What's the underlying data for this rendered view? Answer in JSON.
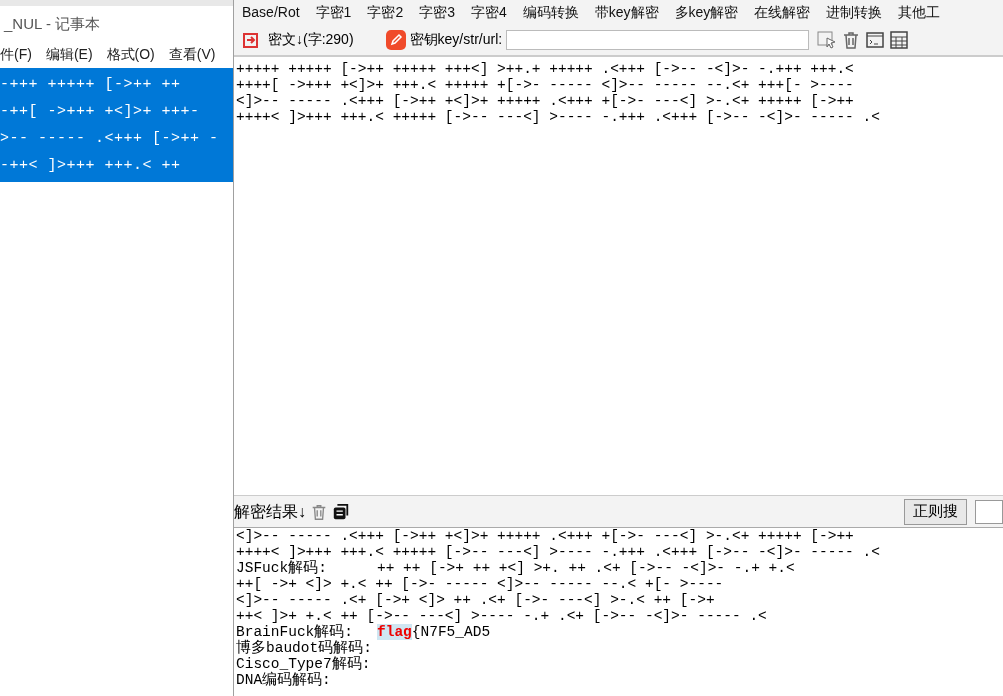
{
  "notepad": {
    "title": "_NUL - 记事本",
    "menu": [
      "件(F)",
      "编辑(E)",
      "格式(O)",
      "查看(V)"
    ],
    "lines": [
      "-+++ +++++ [->++ ++",
      "-++[ ->+++ +<]>+ +++-",
      ">-- ----- .<+++ [->++ -",
      "-++< ]>+++ +++.< ++"
    ]
  },
  "tool": {
    "menu": [
      "Base/Rot",
      "字密1",
      "字密2",
      "字密3",
      "字密4",
      "编码转换",
      "带key解密",
      "多key解密",
      "在线解密",
      "进制转换",
      "其他工"
    ],
    "cipher_label": "密文↓(字:290)",
    "key_label": "密钥key/str/url:",
    "cipher_lines": [
      "+++++ +++++ [->++ +++++ +++<] >++.+ +++++ .<+++ [->-- -<]>- -.+++ +++.<",
      "++++[ ->+++ +<]>+ +++.< +++++ +[->- ----- <]>-- ----- --.<+ +++[- >----",
      "<]>-- ----- .<+++ [->++ +<]>+ +++++ .<+++ +[->- ---<] >-.<+ +++++ [->++",
      "++++< ]>+++ +++.< +++++ [->-- ---<] >---- -.+++ .<+++ [->-- -<]>- ----- .<"
    ],
    "result_label": "解密结果↓",
    "regex_button": "正则搜",
    "results": [
      {
        "kind": "plain",
        "text": "<]>-- ----- .<+++ [->++ +<]>+ +++++ .<+++ +[->- ---<] >-.<+ +++++ [->++"
      },
      {
        "kind": "plain",
        "text": "++++< ]>+++ +++.< +++++ [->-- ---<] >---- -.+++ .<+++ [->-- -<]>- ----- .<"
      },
      {
        "kind": "labeled",
        "label": "JSFuck解码:",
        "value": "++ ++ [->+ ++ +<] >+. ++ .<+ [->-- -<]>- -.+ +.<"
      },
      {
        "kind": "plain",
        "text": "++[ ->+ <]> +.< ++ [->- ----- <]>-- ----- --.< +[- >----"
      },
      {
        "kind": "plain",
        "text": "<]>-- ----- .<+ [->+ <]> ++ .<+ [->- ---<] >-.< ++ [->+"
      },
      {
        "kind": "plain",
        "text": "++< ]>+ +.< ++ [->-- ---<] >---- -.+ .<+ [->-- -<]>- ----- .<"
      },
      {
        "kind": "labeled",
        "label": "BrainFuck解码:",
        "value": "**flag**{N7F5_AD5"
      },
      {
        "kind": "labeled",
        "label": "博多baudot码解码:"
      },
      {
        "kind": "labeled",
        "label": "Cisco_Type7解码:"
      },
      {
        "kind": "labeled",
        "label": "DNA编码解码:"
      }
    ]
  }
}
